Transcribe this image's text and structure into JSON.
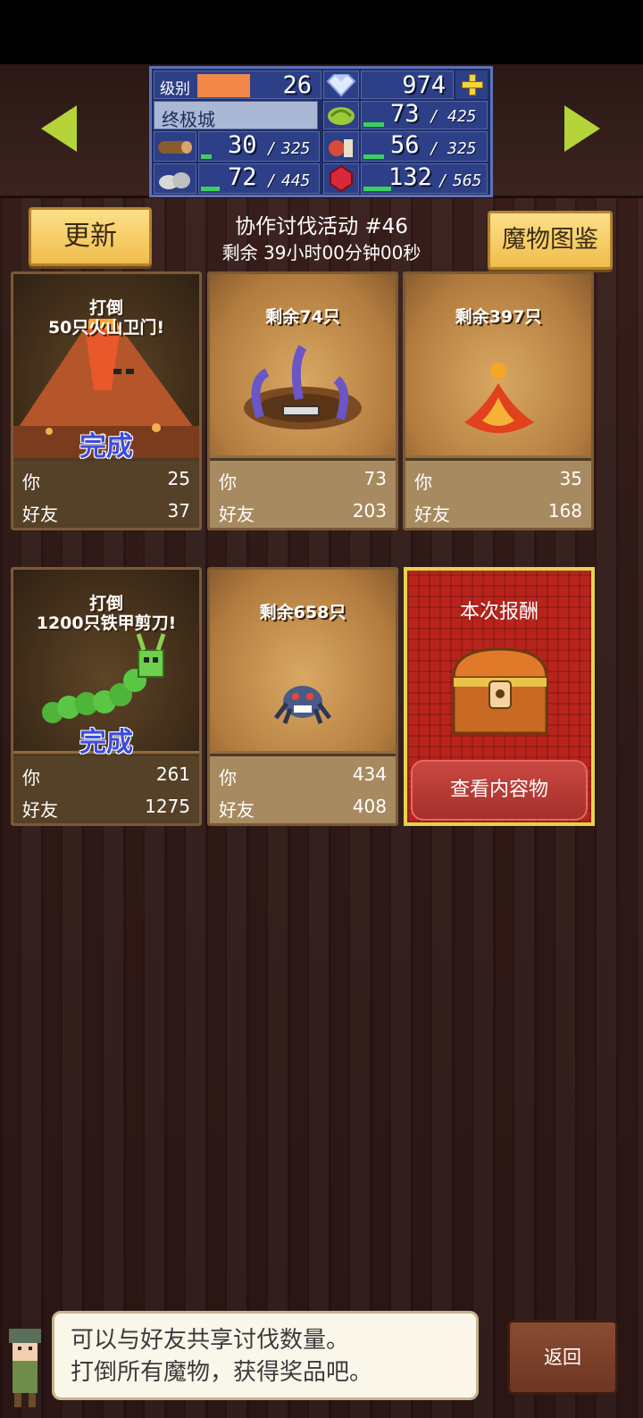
{
  "status": {
    "level_label": "级别",
    "level_value": "26",
    "level_fill": 0.45,
    "gems": "974",
    "town_name": "终极城",
    "resources": [
      {
        "name": "grass",
        "current": "73",
        "max": "425",
        "fill": 0.17
      },
      {
        "name": "wood",
        "current": "30",
        "max": "325",
        "fill": 0.09
      },
      {
        "name": "food",
        "current": "56",
        "max": "325",
        "fill": 0.17
      },
      {
        "name": "stone",
        "current": "72",
        "max": "445",
        "fill": 0.16
      },
      {
        "name": "ruby",
        "current": "132",
        "max": "565",
        "fill": 0.23
      }
    ],
    "separator": "/"
  },
  "header": {
    "refresh_label": "更新",
    "title": "协作讨伐活动 #46",
    "timer": "剩余 39小时00分钟00秒",
    "monster_book_label": "魔物图鉴"
  },
  "cards": [
    {
      "label_line1": "打倒",
      "label_line2": "50只火山卫门!",
      "done": "完成",
      "you_label": "你",
      "you": "25",
      "friend_label": "好友",
      "friend": "37"
    },
    {
      "label_line1": "剩余74只",
      "label_line2": "",
      "done": "",
      "you_label": "你",
      "you": "73",
      "friend_label": "好友",
      "friend": "203"
    },
    {
      "label_line1": "剩余397只",
      "label_line2": "",
      "done": "",
      "you_label": "你",
      "you": "35",
      "friend_label": "好友",
      "friend": "168"
    },
    {
      "label_line1": "打倒",
      "label_line2": "1200只铁甲剪刀!",
      "done": "完成",
      "you_label": "你",
      "you": "261",
      "friend_label": "好友",
      "friend": "1275"
    },
    {
      "label_line1": "剩余658只",
      "label_line2": "",
      "done": "",
      "you_label": "你",
      "you": "434",
      "friend_label": "好友",
      "friend": "408"
    }
  ],
  "reward": {
    "title": "本次报酬",
    "view_contents": "查看内容物"
  },
  "dialog": {
    "line1": "可以与好友共享讨伐数量。",
    "line2": "打倒所有魔物，获得奖品吧。"
  },
  "back_label": "返回",
  "icons": [
    "arrow-left-icon",
    "arrow-right-icon",
    "diamond-icon",
    "plus-icon",
    "grass-icon",
    "wood-icon",
    "food-icon",
    "stone-icon",
    "ruby-icon",
    "treasure-chest-icon"
  ],
  "colors": {
    "accent_green": "#b5d43a",
    "panel_blue": "#2d3f86",
    "button_yellow": "#f0bd4d",
    "reward_red": "#b8241c",
    "done_blue": "#3c4cdd"
  }
}
